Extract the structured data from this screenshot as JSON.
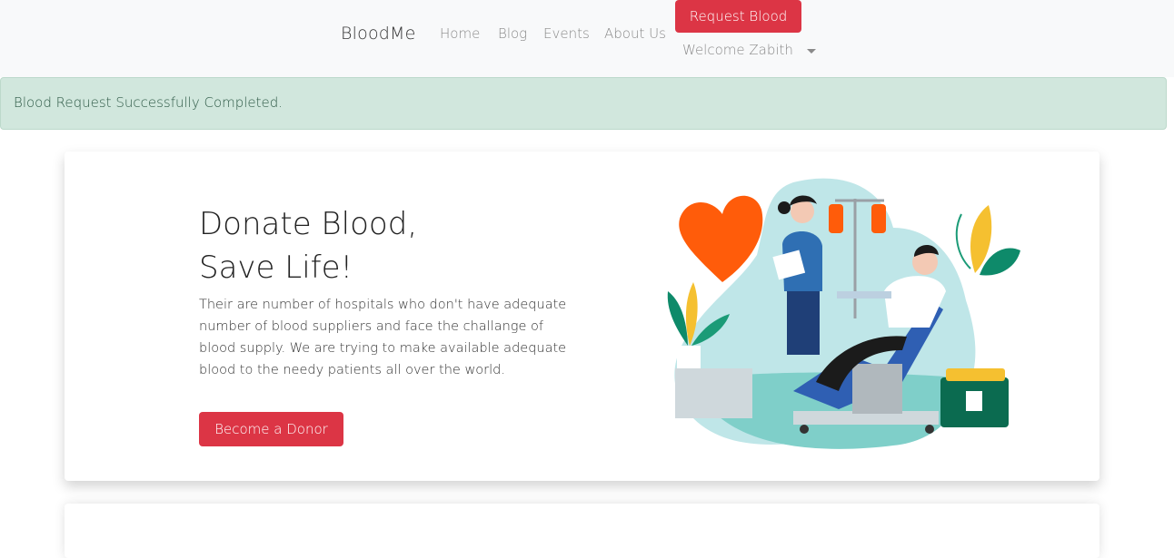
{
  "navbar": {
    "brand": "BloodMe",
    "links": [
      "Home",
      "Blog",
      "Events",
      "About Us"
    ],
    "request_button": "Request Blood",
    "welcome": "Welcome Zabith"
  },
  "alert": {
    "message": "Blood Request Successfully Completed."
  },
  "hero": {
    "title_line1": "Donate Blood,",
    "title_line2": "Save Life!",
    "text": "Their are number of hospitals who don't have adequate number of blood suppliers and face the challange of blood supply. We are trying to make available adequate blood to the needy patients all over the world.",
    "button": "Become a Donor"
  },
  "colors": {
    "accent": "#dc3545",
    "alert_bg": "#d1e7dd",
    "navbar_bg": "#f8f9fa"
  }
}
